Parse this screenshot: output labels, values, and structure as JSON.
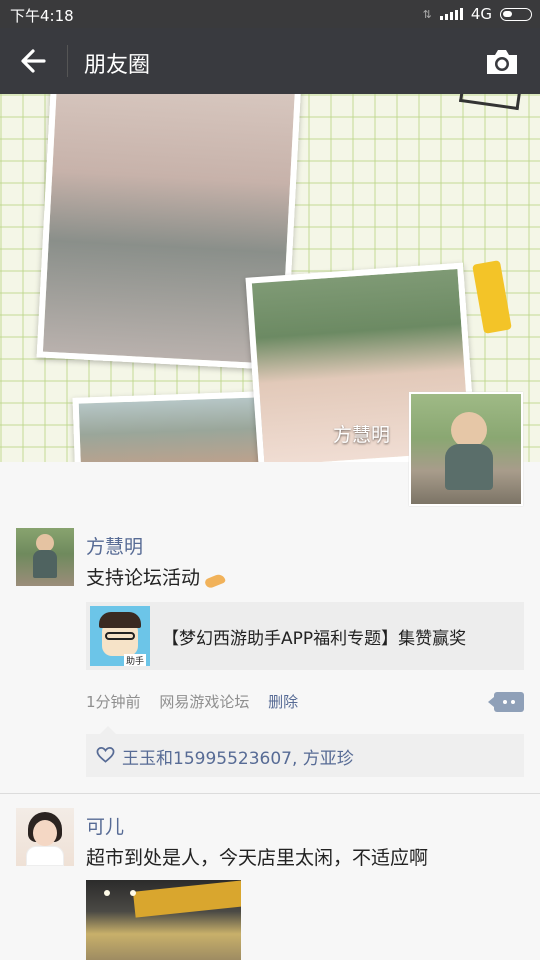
{
  "status_bar": {
    "time": "下午4:18",
    "network": "4G"
  },
  "nav": {
    "title": "朋友圈",
    "back_icon": "arrow-left-icon",
    "camera_icon": "camera-icon"
  },
  "cover": {
    "name": "方慧明"
  },
  "posts": [
    {
      "name": "方慧明",
      "text": "支持论坛活动",
      "emoji": "praying-hands-icon",
      "link": {
        "title": "【梦幻西游助手APP福利专题】集赞赢奖",
        "thumb_tag": "助手"
      },
      "time": "1分钟前",
      "source": "网易游戏论坛",
      "delete_label": "删除",
      "likes": "王玉和15995523607, 方亚珍"
    },
    {
      "name": "可儿",
      "text": "超市到处是人，今天店里太闲，不适应啊"
    }
  ],
  "colors": {
    "nav_background": "#393a3f",
    "link_name": "#576b95",
    "page_background": "#f7f7f7"
  }
}
